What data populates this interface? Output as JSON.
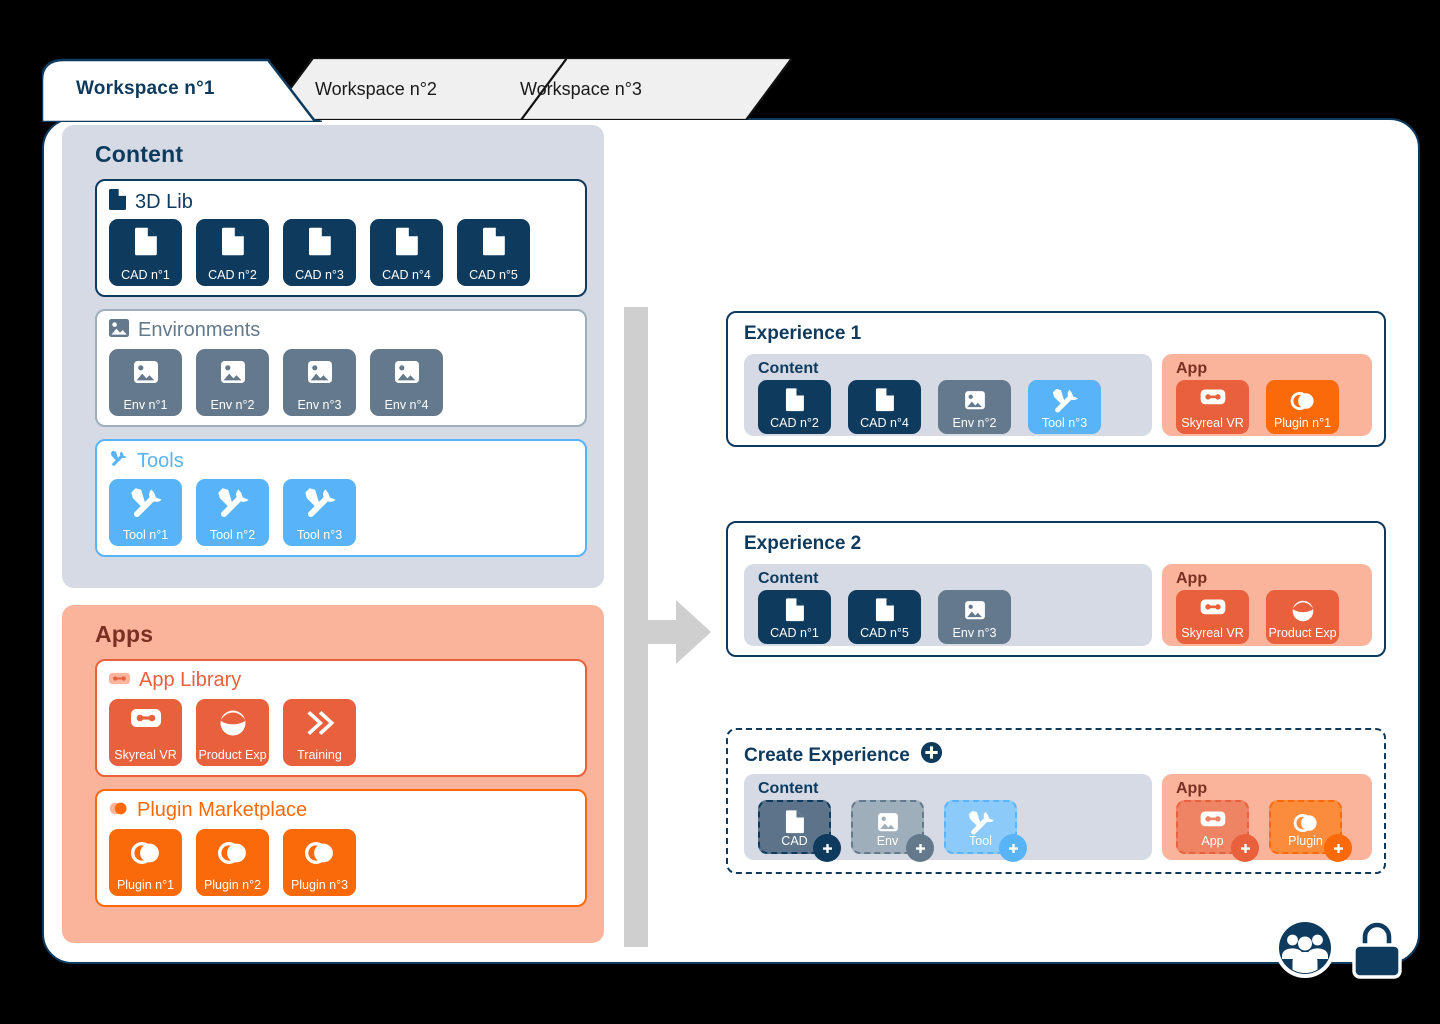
{
  "tabs": [
    {
      "label": "Workspace n°1",
      "active": true
    },
    {
      "label": "Workspace n°2",
      "active": false
    },
    {
      "label": "Workspace n°3",
      "active": false
    }
  ],
  "left": {
    "content_panel": {
      "title": "Content",
      "groups": [
        {
          "name": "3d-lib",
          "title": "3D Lib",
          "icon": "document-icon",
          "accent": "#0E3A5E",
          "items": [
            {
              "label": "CAD n°1",
              "kind": "cad"
            },
            {
              "label": "CAD n°2",
              "kind": "cad"
            },
            {
              "label": "CAD n°3",
              "kind": "cad"
            },
            {
              "label": "CAD n°4",
              "kind": "cad"
            },
            {
              "label": "CAD n°5",
              "kind": "cad"
            }
          ]
        },
        {
          "name": "environments",
          "title": "Environments",
          "icon": "image-icon",
          "accent": "#64798C",
          "items": [
            {
              "label": "Env n°1",
              "kind": "env"
            },
            {
              "label": "Env n°2",
              "kind": "env"
            },
            {
              "label": "Env n°3",
              "kind": "env"
            },
            {
              "label": "Env n°4",
              "kind": "env"
            }
          ]
        },
        {
          "name": "tools",
          "title": "Tools",
          "icon": "tools-icon",
          "accent": "#59B4F7",
          "items": [
            {
              "label": "Tool n°1",
              "kind": "tool"
            },
            {
              "label": "Tool n°2",
              "kind": "tool"
            },
            {
              "label": "Tool n°3",
              "kind": "tool"
            }
          ]
        }
      ]
    },
    "apps_panel": {
      "title": "Apps",
      "groups": [
        {
          "name": "app-library",
          "title": "App Library",
          "icon": "vr-headset-icon",
          "accent": "#E8603C",
          "items": [
            {
              "label": "Skyreal VR",
              "kind": "app",
              "icon": "vr-headset-icon"
            },
            {
              "label": "Product Exp",
              "kind": "app",
              "icon": "dome-icon"
            },
            {
              "label": "Training",
              "kind": "app",
              "icon": "double-chevron-icon"
            }
          ]
        },
        {
          "name": "plugin-marketplace",
          "title": "Plugin Marketplace",
          "icon": "plugin-icon",
          "accent": "#FB6A0A",
          "items": [
            {
              "label": "Plugin n°1",
              "kind": "plugin",
              "icon": "plugin-icon"
            },
            {
              "label": "Plugin n°2",
              "kind": "plugin",
              "icon": "plugin-icon"
            },
            {
              "label": "Plugin n°3",
              "kind": "plugin",
              "icon": "plugin-icon"
            }
          ]
        }
      ]
    }
  },
  "right": {
    "experiences": [
      {
        "title": "Experience 1",
        "content_label": "Content",
        "app_label": "App",
        "content_items": [
          {
            "label": "CAD n°2",
            "kind": "cad"
          },
          {
            "label": "CAD n°4",
            "kind": "cad"
          },
          {
            "label": "Env n°2",
            "kind": "env"
          },
          {
            "label": "Tool n°3",
            "kind": "tool"
          }
        ],
        "app_items": [
          {
            "label": "Skyreal VR",
            "kind": "app",
            "icon": "vr-headset-icon"
          },
          {
            "label": "Plugin n°1",
            "kind": "plugin",
            "icon": "plugin-icon"
          }
        ]
      },
      {
        "title": "Experience 2",
        "content_label": "Content",
        "app_label": "App",
        "content_items": [
          {
            "label": "CAD n°1",
            "kind": "cad"
          },
          {
            "label": "CAD n°5",
            "kind": "cad"
          },
          {
            "label": "Env n°3",
            "kind": "env"
          }
        ],
        "app_items": [
          {
            "label": "Skyreal VR",
            "kind": "app",
            "icon": "vr-headset-icon"
          },
          {
            "label": "Product Exp",
            "kind": "app",
            "icon": "dome-icon"
          }
        ]
      }
    ],
    "create": {
      "title": "Create Experience",
      "add_icon": "plus-circle-icon",
      "content_label": "Content",
      "app_label": "App",
      "content_items": [
        {
          "label": "CAD",
          "kind": "cad-placeholder",
          "badge_color": "#0E3A5E"
        },
        {
          "label": "Env",
          "kind": "env-placeholder",
          "badge_color": "#64798C"
        },
        {
          "label": "Tool",
          "kind": "tool-placeholder",
          "badge_color": "#59B4F7"
        }
      ],
      "app_items": [
        {
          "label": "App",
          "kind": "app-placeholder",
          "icon": "vr-headset-icon",
          "badge_color": "#E8603C"
        },
        {
          "label": "Plugin",
          "kind": "plugin-placeholder",
          "icon": "plugin-icon",
          "badge_color": "#FB6A0A"
        }
      ]
    }
  },
  "flow_arrow": {
    "icon": "right-arrow-icon",
    "color": "#CFCFCF"
  },
  "corner_icons": [
    {
      "name": "users-group-icon"
    },
    {
      "name": "lock-icon"
    }
  ],
  "colors": {
    "navy": "#0E3A5E",
    "slate": "#64798C",
    "blue": "#59B4F7",
    "orange_red": "#E8603C",
    "orange": "#FB6A0A",
    "panel_gray": "#D5DAE5",
    "panel_salmon": "#FBB49C",
    "apps_title": "#7A3021"
  }
}
